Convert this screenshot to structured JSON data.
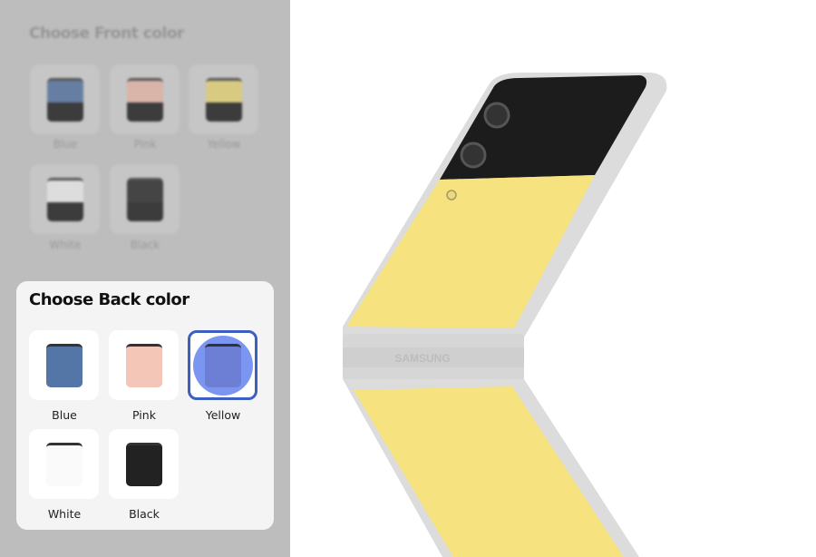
{
  "front": {
    "title": "Choose Front color",
    "options": [
      {
        "label": "Blue",
        "color": "#4a6a98"
      },
      {
        "label": "Pink",
        "color": "#e3b2a2"
      },
      {
        "label": "Yellow",
        "color": "#e2d06e"
      },
      {
        "label": "White",
        "color": "#e8e8e8"
      },
      {
        "label": "Black",
        "color": "#1d1d1d"
      }
    ]
  },
  "back": {
    "title": "Choose Back color",
    "selected": "Yellow",
    "options": [
      {
        "label": "Blue",
        "color": "#5476a6"
      },
      {
        "label": "Pink",
        "color": "#f3c6b8"
      },
      {
        "label": "Yellow",
        "color": "#6d7fd4"
      },
      {
        "label": "White",
        "color": "#fafafa"
      },
      {
        "label": "Black",
        "color": "#222222"
      }
    ]
  },
  "phone": {
    "brand_text": "SAMSUNG",
    "body_color": "#f6e27e",
    "frame_color": "#d9d9d9"
  }
}
